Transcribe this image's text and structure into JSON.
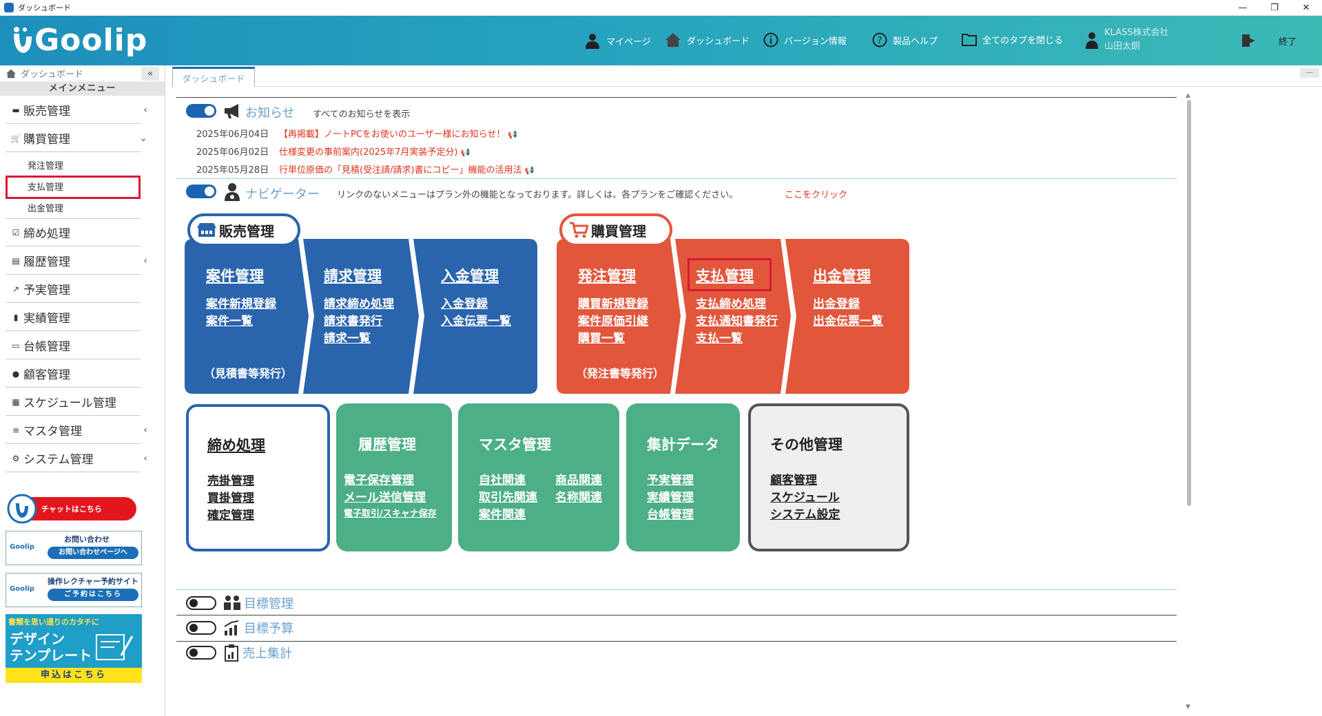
{
  "window": {
    "title": "ダッシュボード",
    "minimize": "—",
    "restore": "❐",
    "close": "✕"
  },
  "header": {
    "logo": "Goolip",
    "nav": [
      {
        "label": "マイページ",
        "icon": "person-icon"
      },
      {
        "label": "ダッシュボード",
        "icon": "home-icon"
      },
      {
        "label": "バージョン情報",
        "icon": "info-icon"
      },
      {
        "label": "製品ヘルプ",
        "icon": "help-icon"
      },
      {
        "label": "全てのタブを閉じる",
        "icon": "folder-icon"
      }
    ],
    "user": {
      "company": "KLASS株式会社",
      "name": "山田太朗"
    },
    "exit": "終了"
  },
  "sidebar": {
    "breadcrumb": "ダッシュボード",
    "collapse": "«",
    "heading": "メインメニュー",
    "items": [
      {
        "label": "販売管理",
        "icon": "register-icon",
        "chev": "‹"
      },
      {
        "label": "購買管理",
        "icon": "cart-icon",
        "chev": "⌄"
      },
      {
        "label": "締め処理",
        "icon": "check-icon",
        "chev": ""
      },
      {
        "label": "履歴管理",
        "icon": "history-icon",
        "chev": "‹"
      },
      {
        "label": "予実管理",
        "icon": "chart-icon",
        "chev": ""
      },
      {
        "label": "実績管理",
        "icon": "bookmark-icon",
        "chev": ""
      },
      {
        "label": "台帳管理",
        "icon": "book-icon",
        "chev": ""
      },
      {
        "label": "顧客管理",
        "icon": "people-icon",
        "chev": ""
      },
      {
        "label": "スケジュール管理",
        "icon": "calendar-icon",
        "chev": ""
      },
      {
        "label": "マスタ管理",
        "icon": "database-icon",
        "chev": "‹"
      },
      {
        "label": "システム管理",
        "icon": "gear-icon",
        "chev": "‹"
      }
    ],
    "subitems": [
      "発注管理",
      "支払管理",
      "出金管理"
    ],
    "banners": {
      "chat": "チャットはこちら",
      "contact_title": "お問い合わせ",
      "contact_btn": "お問い合わせページへ",
      "lecture_title": "操作レクチャー予約サイト",
      "lecture_btn": "ご予約はこちら",
      "logo_small": "Goolip",
      "design_top": "書類を思い通りのカタチに",
      "design_l1": "デザイン",
      "design_l2": "テンプレート",
      "design_btn": "申込はこちら"
    }
  },
  "tabs": [
    {
      "label": "ダッシュボード"
    }
  ],
  "notices": {
    "title": "お知らせ",
    "show_all": "すべてのお知らせを表示",
    "items": [
      {
        "date": "2025年06月04日",
        "text": "【再掲載】ノートPCをお使いのユーザー様にお知らせ！"
      },
      {
        "date": "2025年06月02日",
        "text": "仕様変更の事前案内(2025年7月実装予定分)"
      },
      {
        "date": "2025年05月28日",
        "text": "行単位原価の「見積(受注請/請求)書にコピー」機能の活用法"
      }
    ]
  },
  "navigator": {
    "title": "ナビゲーター",
    "desc": "リンクのないメニューはプラン外の機能となっております。詳しくは、各プランをご確認ください。",
    "link": "ここをクリック"
  },
  "sales": {
    "label": "販売管理",
    "cards": [
      {
        "title": "案件管理",
        "links": [
          "案件新規登録",
          "案件一覧"
        ],
        "note": "（見積書等発行）"
      },
      {
        "title": "請求管理",
        "links": [
          "請求締め処理",
          "請求書発行",
          "請求一覧"
        ]
      },
      {
        "title": "入金管理",
        "links": [
          "入金登録",
          "入金伝票一覧"
        ]
      }
    ]
  },
  "purchase": {
    "label": "購買管理",
    "cards": [
      {
        "title": "発注管理",
        "links": [
          "購買新規登録",
          "案件原価引継",
          "購買一覧"
        ],
        "note": "（発注書等発行）"
      },
      {
        "title": "支払管理",
        "links": [
          "支払締め処理",
          "支払通知書発行",
          "支払一覧"
        ]
      },
      {
        "title": "出金管理",
        "links": [
          "出金登録",
          "出金伝票一覧"
        ]
      }
    ]
  },
  "boxes": {
    "closing": {
      "title": "締め処理",
      "links": [
        "売掛管理",
        "買掛管理",
        "確定管理"
      ]
    },
    "history": {
      "title": "履歴管理",
      "links": [
        "電子保存管理",
        "メール送信管理",
        "電子取引/スキャナ保存"
      ]
    },
    "master": {
      "title": "マスタ管理",
      "links": [
        "自社関連",
        "商品関連",
        "取引先関連",
        "名称関連",
        "案件関連"
      ]
    },
    "agg": {
      "title": "集計データ",
      "links": [
        "予実管理",
        "実績管理",
        "台帳管理"
      ]
    },
    "other": {
      "title": "その他管理",
      "links": [
        "顧客管理",
        "スケジュール",
        "システム設定"
      ]
    }
  },
  "collapsed": [
    {
      "label": "目標管理",
      "icon": "team-icon"
    },
    {
      "label": "目標予算",
      "icon": "growth-icon"
    },
    {
      "label": "売上集計",
      "icon": "report-icon"
    }
  ],
  "colors": {
    "header_start": "#1e8fbc",
    "header_end": "#3cbab6",
    "sales": "#2a64ad",
    "purchase": "#e2563b",
    "green": "#4caf86",
    "highlight": "#d71a32"
  }
}
